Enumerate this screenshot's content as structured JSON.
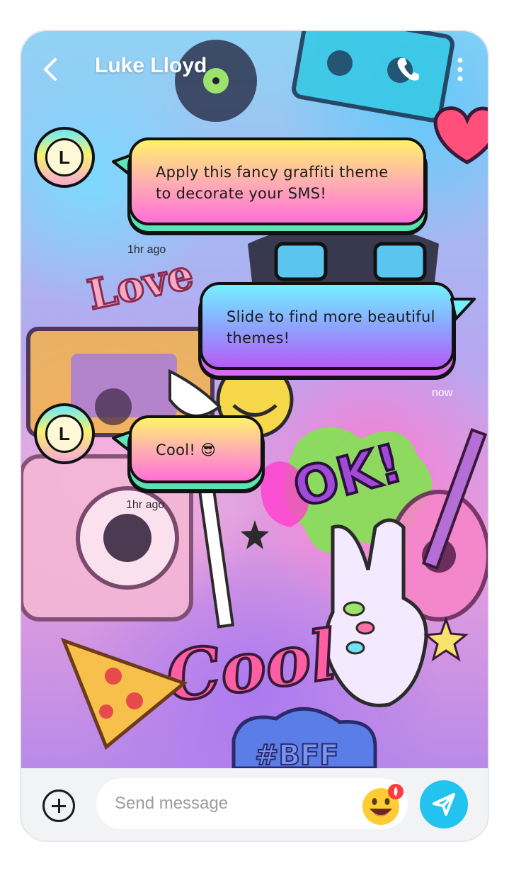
{
  "header": {
    "title": "Luke Lloyd",
    "back_icon": "chevron-left-icon",
    "call_icon": "phone-icon",
    "more_icon": "more-vertical-icon"
  },
  "messages": [
    {
      "direction": "incoming",
      "avatar_letter": "L",
      "lines": [
        "Apply this fancy graffiti theme",
        "to decorate your SMS!"
      ],
      "time": "1hr ago"
    },
    {
      "direction": "outgoing",
      "lines": [
        "Slide to find more beautiful",
        "themes!"
      ],
      "time": "now"
    },
    {
      "direction": "incoming",
      "avatar_letter": "L",
      "lines": [
        "Cool! 😎"
      ],
      "time": "1hr ago"
    }
  ],
  "composer": {
    "placeholder": "Send message",
    "add_icon": "plus-circle-icon",
    "emoji_icon": "grinning-face-icon",
    "send_icon": "send-icon"
  },
  "wallpaper": {
    "stickers": [
      "Love",
      "OK!",
      "Cool",
      "#BFF"
    ]
  },
  "colors": {
    "incoming_bubble": "#ff6fd8",
    "outgoing_bubble": "#8ca6ff",
    "send_button": "#22c3ee",
    "composer_bg": "#f2f3f5"
  }
}
